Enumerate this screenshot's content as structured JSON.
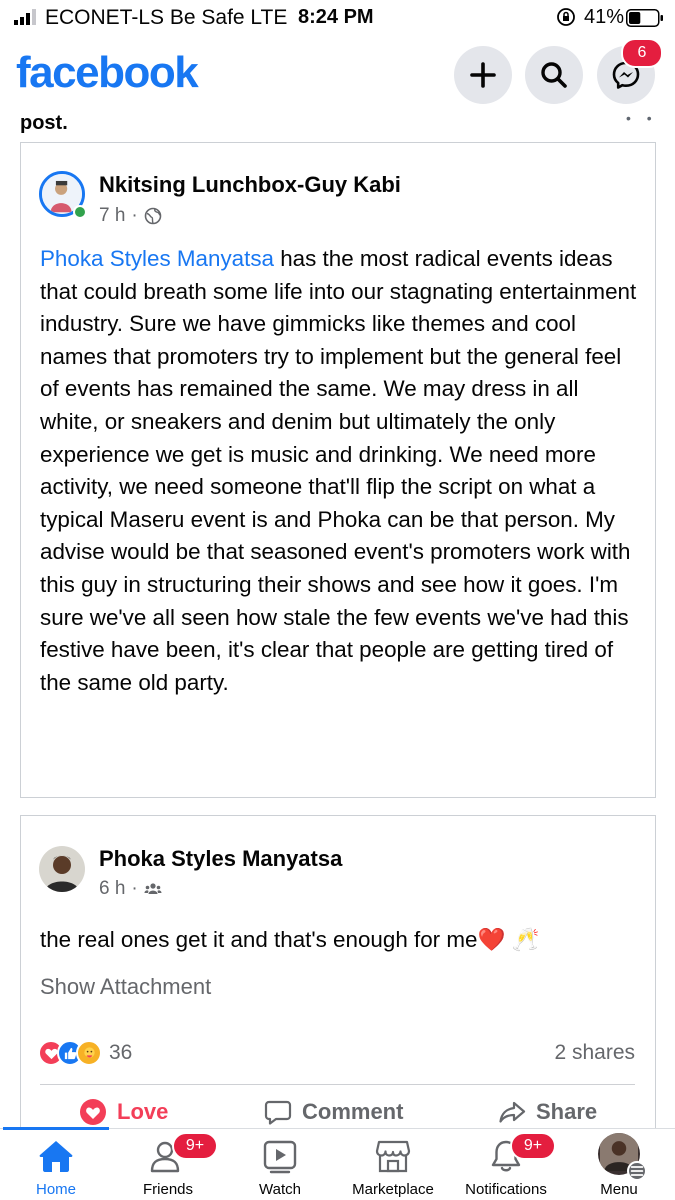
{
  "status_bar": {
    "carrier": "ECONET-LS Be Safe  LTE",
    "time": "8:24 PM",
    "battery_percent": "41%",
    "battery_level": 0.41
  },
  "header": {
    "logo": "facebook",
    "messenger_badge": "6",
    "icons": [
      "plus-icon",
      "search-icon",
      "messenger-icon"
    ]
  },
  "cut_text": "post.",
  "posts": [
    {
      "author": "Nkitsing Lunchbox-Guy Kabi",
      "time": "7 h",
      "audience_icon": "globe-icon",
      "mention": "Phoka Styles Manyatsa",
      "body": " has the most radical events ideas that could breath some life into our stagnating entertainment industry. Sure we have gimmicks like themes and cool names that promoters try to implement but the general feel of events has remained the same. We may dress in all white,  or sneakers and denim but ultimately the only experience we get is music and drinking. We need more activity, we need someone that'll flip the script on what a typical Maseru event is and Phoka can be that person. My advise would be that seasoned event's promoters work with this guy in structuring their shows and see how it goes. I'm sure we've all seen how stale the few events we've had this festive have been, it's clear that people are getting tired of the same old party."
    },
    {
      "author": "Phoka Styles Manyatsa",
      "time": "6 h",
      "audience_icon": "group-icon",
      "body": "the real ones get it and that's enough for me❤️ 🥂",
      "show_attachment": "Show Attachment",
      "reaction_count": "36",
      "shares": "2 shares",
      "actions": {
        "love": "Love",
        "comment": "Comment",
        "share": "Share"
      }
    }
  ],
  "tabbar": {
    "tabs": [
      {
        "label": "Home",
        "icon": "home-icon",
        "active": true
      },
      {
        "label": "Friends",
        "icon": "friends-icon",
        "badge": "9+"
      },
      {
        "label": "Watch",
        "icon": "watch-icon"
      },
      {
        "label": "Marketplace",
        "icon": "marketplace-icon"
      },
      {
        "label": "Notifications",
        "icon": "bell-icon",
        "badge": "9+"
      },
      {
        "label": "Menu",
        "icon": "menu-icon"
      }
    ]
  },
  "colors": {
    "brand": "#1877f2",
    "love": "#f33e58",
    "badge": "#e41e3f",
    "muted": "#65676b"
  }
}
